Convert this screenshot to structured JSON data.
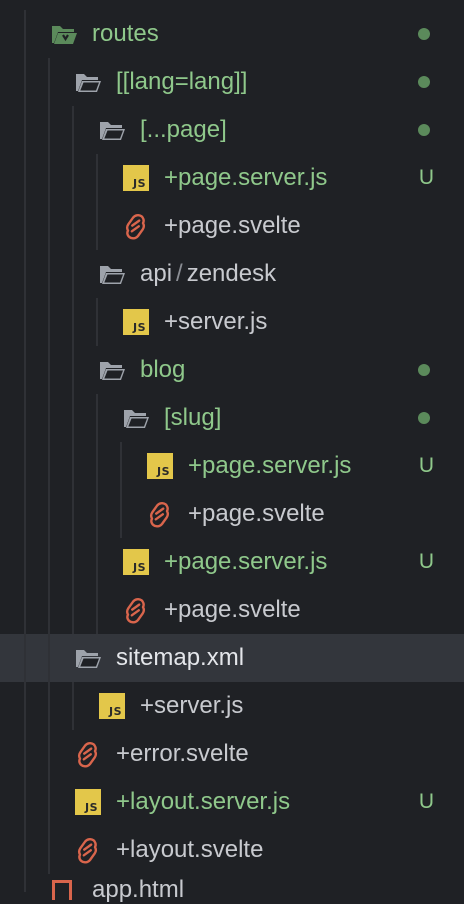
{
  "colors": {
    "background": "#1f2125",
    "selected_row": "#33363c",
    "modified_green": "#8fc88b",
    "dot_green": "#5b8a5b",
    "js_badge": "#e3c74a",
    "svelte_orange": "#d9654c",
    "folder_grey": "#9ea3ab"
  },
  "tree": {
    "routes": {
      "label": "routes",
      "icon": "folder-open-routes-icon"
    },
    "lang": {
      "label": "[[lang=lang]]"
    },
    "page_folder": {
      "label": "[...page]"
    },
    "page_server_1": {
      "label": "+page.server.js",
      "status": "U",
      "icon": "js-file-icon"
    },
    "page_svelte_1": {
      "label": "+page.svelte",
      "icon": "svelte-file-icon"
    },
    "api_zendesk": {
      "label_a": "api",
      "separator": "/",
      "label_b": "zendesk"
    },
    "server_js_1": {
      "label": "+server.js"
    },
    "blog": {
      "label": "blog"
    },
    "slug": {
      "label": "[slug]"
    },
    "page_server_2": {
      "label": "+page.server.js",
      "status": "U"
    },
    "page_svelte_2": {
      "label": "+page.svelte"
    },
    "page_server_3": {
      "label": "+page.server.js",
      "status": "U"
    },
    "page_svelte_3": {
      "label": "+page.svelte"
    },
    "sitemap": {
      "label": "sitemap.xml"
    },
    "server_js_2": {
      "label": "+server.js"
    },
    "error_svelte": {
      "label": "+error.svelte"
    },
    "layout_server": {
      "label": "+layout.server.js",
      "status": "U"
    },
    "layout_svelte": {
      "label": "+layout.svelte"
    },
    "partial_next": {
      "label": "app.html"
    }
  },
  "js_badge_text": "JS"
}
